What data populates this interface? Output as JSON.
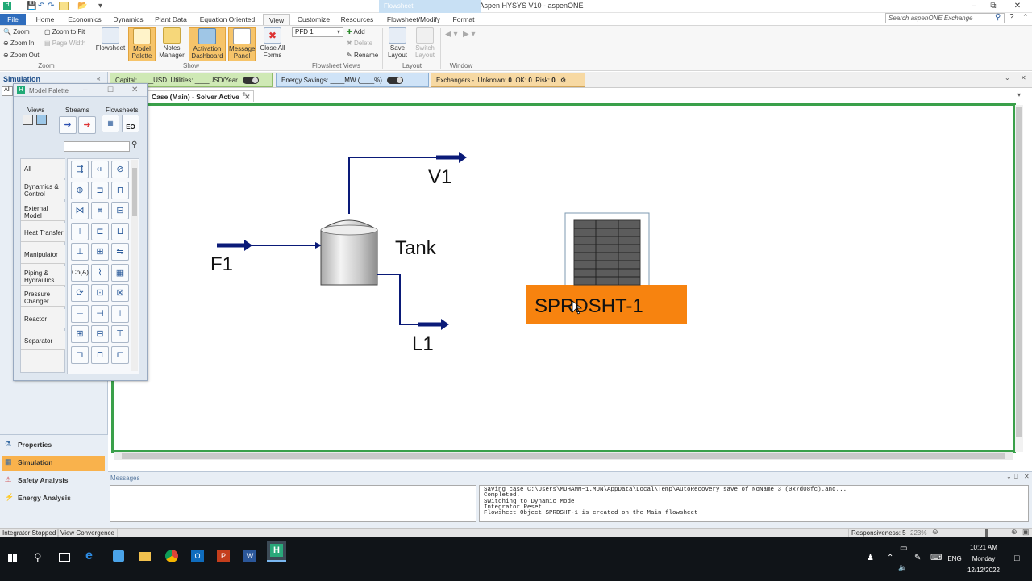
{
  "window": {
    "title": "Untitled - Aspen HYSYS V10 - aspenONE",
    "context_tab": "Flowsheet"
  },
  "search": {
    "placeholder": "Search aspenONE Exchange"
  },
  "tabs": [
    "File",
    "Home",
    "Economics",
    "Dynamics",
    "Plant Data",
    "Equation Oriented",
    "View",
    "Customize",
    "Resources",
    "Flowsheet/Modify",
    "Format"
  ],
  "ribbon": {
    "zoom": {
      "zoom": "Zoom",
      "zoom_in": "Zoom In",
      "zoom_out": "Zoom Out",
      "zoom_fit": "Zoom to Fit",
      "page_width": "Page Width",
      "group": "Zoom"
    },
    "show": {
      "flowsheet": "Flowsheet",
      "model_palette": [
        "Model",
        "Palette"
      ],
      "notes": [
        "Notes",
        "Manager"
      ],
      "activation": [
        "Activation",
        "Dashboard"
      ],
      "message_panel": [
        "Message",
        "Panel"
      ],
      "close_all": [
        "Close All",
        "Forms"
      ],
      "group": "Show"
    },
    "views": {
      "pfd_value": "PFD 1",
      "add": "Add",
      "delete": "Delete",
      "rename": "Rename",
      "group": "Flowsheet Views"
    },
    "layout": {
      "save": [
        "Save",
        "Layout"
      ],
      "switch": [
        "Switch",
        "Layout"
      ],
      "group": "Layout"
    },
    "window": {
      "group": "Window"
    }
  },
  "costbar": {
    "capital": "Capital: ____USD",
    "utilities": "Utilities: ____USD/Year",
    "energy": "Energy Savings: ____MW    (____%)",
    "exchangers": "Exchangers -",
    "unknown_label": "Unknown:",
    "unknown": "0",
    "ok_label": "OK:",
    "ok": "0",
    "risk_label": "Risk:",
    "risk": "0"
  },
  "leftnav": {
    "header": "Simulation",
    "filter": "All",
    "items": [
      "Properties",
      "Simulation",
      "Safety Analysis",
      "Energy Analysis"
    ]
  },
  "palette": {
    "title": "Model Palette",
    "headers": [
      "Views",
      "Streams",
      "Flowsheets"
    ],
    "eo": "EO",
    "categories": [
      [
        "All"
      ],
      [
        "Dynamics &",
        "Control"
      ],
      [
        "External",
        "Model"
      ],
      [
        "Heat Transfer"
      ],
      [
        "Manipulator"
      ],
      [
        "Piping &",
        "Hydraulics"
      ],
      [
        "Pressure",
        "Changer"
      ],
      [
        "Reactor"
      ],
      [
        "Separator"
      ]
    ],
    "formula_icon": "Cn(A)",
    "icons": [
      "mixer-icon",
      "tee-icon",
      "valve-icon",
      "pump-icon",
      "compressor-icon",
      "expander-icon",
      "heater-icon",
      "cooler-icon",
      "exchanger-icon",
      "flash-icon",
      "tank-icon",
      "column-icon",
      "pipe-icon",
      "cstr-icon",
      "pfr-icon",
      "recycle-icon",
      "adjust-icon",
      "spreadsheet-icon",
      "controller-icon",
      "component-splitter-icon",
      "set-icon",
      "separator-icon",
      "absorber-icon",
      "distillation-icon",
      "reboiler-icon",
      "condenser-icon",
      "relief-icon",
      "filter-icon",
      "cyclone-icon",
      "ejector-icon"
    ]
  },
  "doc": {
    "tab": "Case (Main) - Solver Active"
  },
  "flowsheet": {
    "streams": [
      "F1",
      "V1",
      "L1"
    ],
    "unit": "Tank",
    "spreadsheet": "SPRDSHT-1",
    "stream_color": "#0a1a78",
    "spreadsheet_color": "#f7830f"
  },
  "messages": {
    "title": "Messages",
    "lines": [
      "Saving case C:\\Users\\MUHAMM~1.MUN\\AppData\\Local\\Temp\\AutoRecovery save of NoName_3 (0x7d08fc).anc...",
      "",
      "Completed.",
      "Switching to Dynamic Mode",
      "Integrator Reset",
      "Flowsheet Object SPRDSHT-1 is created on the Main flowsheet"
    ]
  },
  "status": {
    "integrator": "Integrator Stopped",
    "convergence": "View Convergence",
    "responsiveness": "Responsiveness: 5",
    "zoom": "223%"
  },
  "taskbar": {
    "time": "10:21 AM",
    "day": "Monday",
    "date": "12/12/2022",
    "lang": "ENG"
  }
}
